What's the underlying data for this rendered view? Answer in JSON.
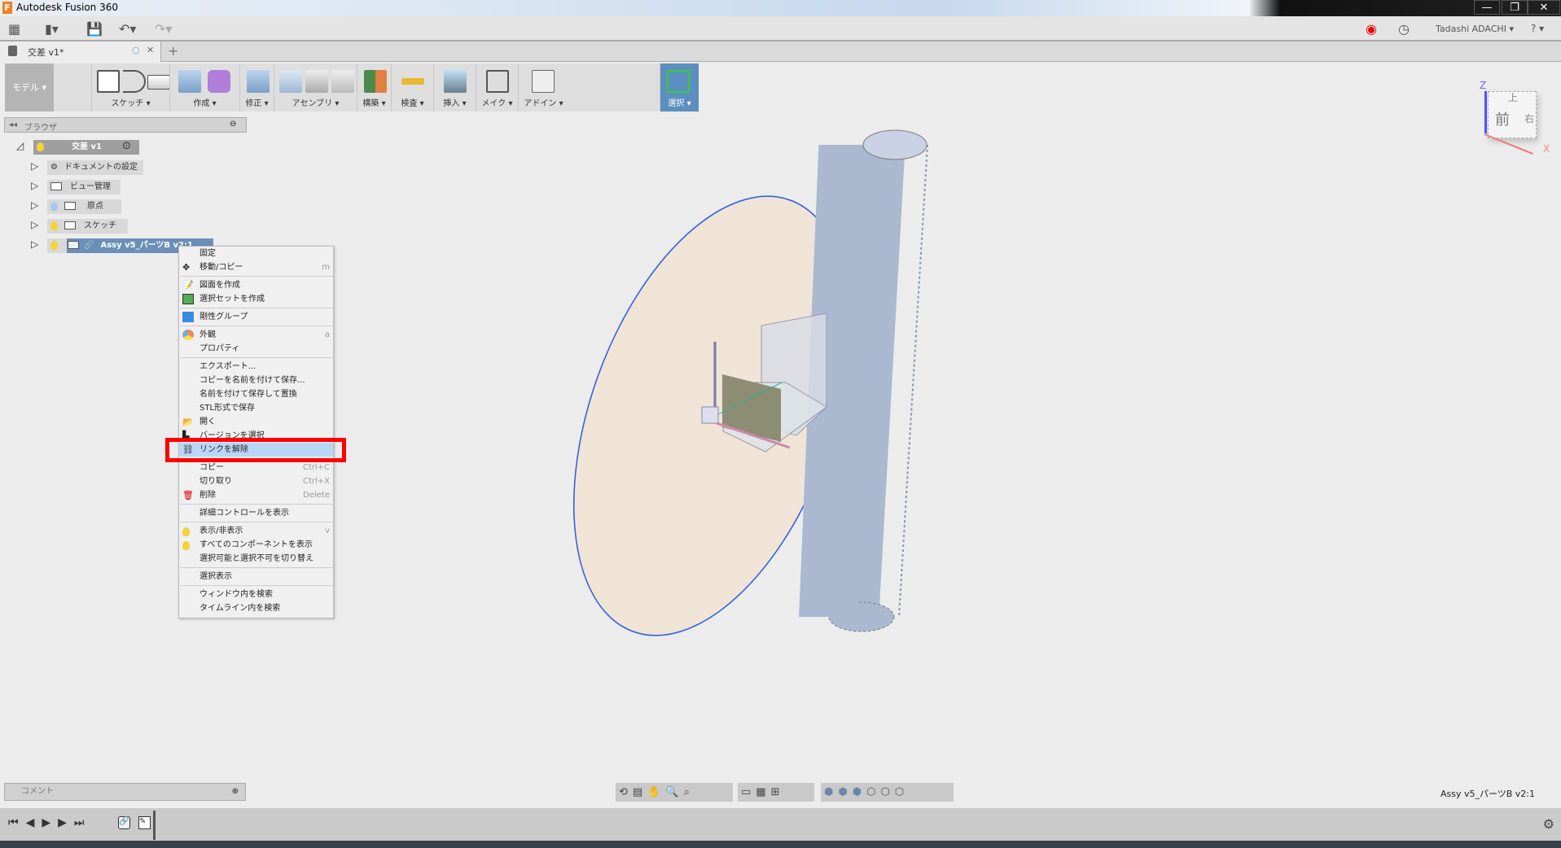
{
  "window": {
    "title": "Autodesk Fusion 360",
    "minimize": "—",
    "restore": "❐",
    "close": "✕"
  },
  "header": {
    "user": "Tadashi ADACHI ▾",
    "help": "? ▾"
  },
  "document_tab": {
    "label": "交差 v1*",
    "close": "✕",
    "new_tab": "+"
  },
  "ribbon": {
    "workspace": "モデル ▾",
    "groups": [
      {
        "label": "スケッチ ▾"
      },
      {
        "label": "作成 ▾"
      },
      {
        "label": "修正 ▾"
      },
      {
        "label": "アセンブリ ▾"
      },
      {
        "label": "構築 ▾"
      },
      {
        "label": "検査 ▾"
      },
      {
        "label": "挿入 ▾"
      },
      {
        "label": "メイク ▾"
      },
      {
        "label": "アドイン ▾"
      },
      {
        "label": "選択 ▾"
      }
    ]
  },
  "browser": {
    "title": "ブラウザ",
    "root": "交差 v1",
    "items": [
      {
        "label": "ドキュメントの設定"
      },
      {
        "label": "ビュー管理"
      },
      {
        "label": "原点"
      },
      {
        "label": "スケッチ"
      },
      {
        "label": "Assy v5_パーツB v2:1"
      }
    ]
  },
  "context_menu": {
    "items": [
      {
        "label": "固定",
        "shortcut": ""
      },
      {
        "label": "移動/コピー",
        "shortcut": "m"
      },
      {
        "label": "図面を作成",
        "shortcut": ""
      },
      {
        "label": "選択セットを作成",
        "shortcut": ""
      },
      {
        "label": "剛性グループ",
        "shortcut": ""
      },
      {
        "label": "外観",
        "shortcut": "a"
      },
      {
        "label": "プロパティ",
        "shortcut": ""
      },
      {
        "label": "エクスポート...",
        "shortcut": ""
      },
      {
        "label": "コピーを名前を付けて保存...",
        "shortcut": ""
      },
      {
        "label": "名前を付けて保存して置換",
        "shortcut": ""
      },
      {
        "label": "STL形式で保存",
        "shortcut": ""
      },
      {
        "label": "開く",
        "shortcut": ""
      },
      {
        "label": "バージョンを選択",
        "shortcut": ""
      },
      {
        "label": "リンクを解除",
        "shortcut": ""
      },
      {
        "label": "コピー",
        "shortcut": "Ctrl+C"
      },
      {
        "label": "切り取り",
        "shortcut": "Ctrl+X"
      },
      {
        "label": "削除",
        "shortcut": "Delete"
      },
      {
        "label": "詳細コントロールを表示",
        "shortcut": ""
      },
      {
        "label": "表示/非表示",
        "shortcut": "v"
      },
      {
        "label": "すべてのコンポーネントを表示",
        "shortcut": ""
      },
      {
        "label": "選択可能と選択不可を切り替え",
        "shortcut": ""
      },
      {
        "label": "選択表示",
        "shortcut": ""
      },
      {
        "label": "ウィンドウ内を検索",
        "shortcut": ""
      },
      {
        "label": "タイムライン内を検索",
        "shortcut": ""
      }
    ]
  },
  "viewcube": {
    "top": "上",
    "front": "前",
    "right": "右",
    "z": "Z",
    "x": "X"
  },
  "comments": {
    "label": "コメント"
  },
  "status": {
    "selection": "Assy v5_パーツB v2:1"
  },
  "colors": {
    "highlight": "#b9d6f7",
    "red_box": "#ff0000",
    "selected_row": "#6b8fb8"
  }
}
